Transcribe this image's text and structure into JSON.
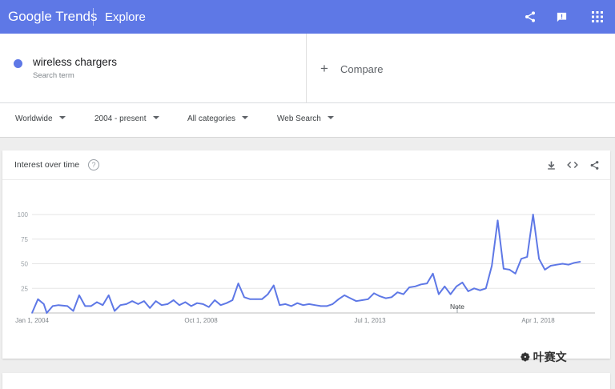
{
  "header": {
    "logo_text": "Google Trends",
    "nav_title": "Explore",
    "brand_color": "#5e78e6",
    "icons": [
      "share-icon",
      "feedback-icon",
      "apps-grid-icon"
    ]
  },
  "search": {
    "term": "wireless chargers",
    "term_sublabel": "Search term",
    "term_color": "#5e78e6",
    "compare_label": "Compare"
  },
  "filters": {
    "region": "Worldwide",
    "time_range": "2004 - present",
    "category": "All categories",
    "search_type": "Web Search"
  },
  "interest_card": {
    "title": "Interest over time",
    "help_label": "?",
    "icons": [
      "download-icon",
      "embed-code-icon",
      "share-icon"
    ],
    "note_label": "Note"
  },
  "watermark": {
    "text": "叶赛文"
  },
  "chart_data": {
    "type": "line",
    "title": "",
    "xlabel": "",
    "ylabel": "",
    "ylim": [
      0,
      100
    ],
    "y_ticks": [
      100,
      75,
      50,
      25
    ],
    "x_ticks": [
      "Jan 1, 2004",
      "Oct 1, 2008",
      "Jul 1, 2013",
      "Apr 1, 2018"
    ],
    "grid": true,
    "x_start": "2004-01",
    "x_end": "2019-12",
    "series": [
      {
        "name": "wireless chargers",
        "color": "#5e78e6",
        "points": [
          [
            "2004-01",
            0
          ],
          [
            "2004-03",
            14
          ],
          [
            "2004-05",
            9
          ],
          [
            "2004-06",
            0
          ],
          [
            "2004-08",
            7
          ],
          [
            "2004-10",
            8
          ],
          [
            "2005-01",
            7
          ],
          [
            "2005-03",
            2
          ],
          [
            "2005-05",
            18
          ],
          [
            "2005-07",
            7
          ],
          [
            "2005-09",
            7
          ],
          [
            "2005-11",
            11
          ],
          [
            "2006-01",
            8
          ],
          [
            "2006-03",
            18
          ],
          [
            "2006-05",
            2
          ],
          [
            "2006-07",
            8
          ],
          [
            "2006-09",
            9
          ],
          [
            "2006-11",
            12
          ],
          [
            "2007-01",
            9
          ],
          [
            "2007-03",
            12
          ],
          [
            "2007-05",
            5
          ],
          [
            "2007-07",
            12
          ],
          [
            "2007-09",
            8
          ],
          [
            "2007-11",
            9
          ],
          [
            "2008-01",
            13
          ],
          [
            "2008-03",
            8
          ],
          [
            "2008-05",
            11
          ],
          [
            "2008-07",
            7
          ],
          [
            "2008-09",
            10
          ],
          [
            "2008-11",
            9
          ],
          [
            "2009-01",
            6
          ],
          [
            "2009-03",
            13
          ],
          [
            "2009-05",
            8
          ],
          [
            "2009-07",
            10
          ],
          [
            "2009-09",
            13
          ],
          [
            "2009-11",
            30
          ],
          [
            "2010-01",
            16
          ],
          [
            "2010-03",
            14
          ],
          [
            "2010-05",
            14
          ],
          [
            "2010-07",
            14
          ],
          [
            "2010-09",
            19
          ],
          [
            "2010-11",
            28
          ],
          [
            "2011-01",
            8
          ],
          [
            "2011-03",
            9
          ],
          [
            "2011-05",
            7
          ],
          [
            "2011-07",
            10
          ],
          [
            "2011-09",
            8
          ],
          [
            "2011-11",
            9
          ],
          [
            "2012-01",
            8
          ],
          [
            "2012-03",
            7
          ],
          [
            "2012-05",
            7
          ],
          [
            "2012-07",
            9
          ],
          [
            "2012-09",
            14
          ],
          [
            "2012-11",
            18
          ],
          [
            "2013-01",
            15
          ],
          [
            "2013-03",
            12
          ],
          [
            "2013-05",
            13
          ],
          [
            "2013-07",
            14
          ],
          [
            "2013-09",
            20
          ],
          [
            "2013-11",
            17
          ],
          [
            "2014-01",
            15
          ],
          [
            "2014-03",
            16
          ],
          [
            "2014-05",
            21
          ],
          [
            "2014-07",
            19
          ],
          [
            "2014-09",
            26
          ],
          [
            "2014-11",
            27
          ],
          [
            "2015-01",
            29
          ],
          [
            "2015-03",
            30
          ],
          [
            "2015-05",
            40
          ],
          [
            "2015-07",
            19
          ],
          [
            "2015-09",
            27
          ],
          [
            "2015-11",
            19
          ],
          [
            "2016-01",
            27
          ],
          [
            "2016-03",
            31
          ],
          [
            "2016-05",
            22
          ],
          [
            "2016-07",
            25
          ],
          [
            "2016-09",
            23
          ],
          [
            "2016-11",
            25
          ],
          [
            "2017-01",
            48
          ],
          [
            "2017-03",
            94
          ],
          [
            "2017-05",
            45
          ],
          [
            "2017-07",
            44
          ],
          [
            "2017-09",
            40
          ],
          [
            "2017-11",
            55
          ],
          [
            "2018-01",
            57
          ],
          [
            "2018-03",
            100
          ],
          [
            "2018-05",
            55
          ],
          [
            "2018-07",
            44
          ],
          [
            "2018-09",
            48
          ],
          [
            "2018-11",
            49
          ],
          [
            "2019-01",
            50
          ],
          [
            "2019-03",
            49
          ],
          [
            "2019-05",
            51
          ],
          [
            "2019-07",
            52
          ]
        ]
      }
    ]
  }
}
